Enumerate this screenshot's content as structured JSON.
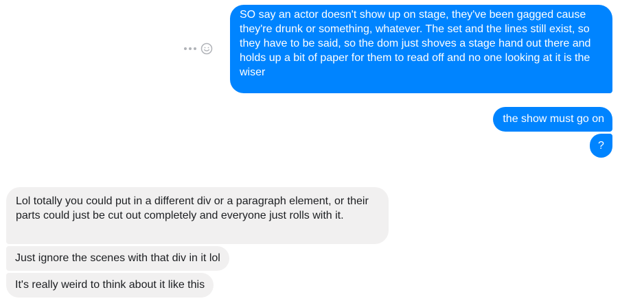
{
  "thread": {
    "outgoing": [
      {
        "text": "SO say an actor doesn't show up on stage, they've been gagged cause they're drunk or something, whatever. The set and the lines still exist, so they have to be said, so the dom just shoves a stage hand out there and holds up a bit of paper for them to read off and no one looking at it is the wiser"
      },
      {
        "text": "the show must go on"
      },
      {
        "text": "?"
      }
    ],
    "incoming": [
      {
        "text": "Lol totally you could put in a different div or a paragraph element, or their parts could just be cut out completely and everyone just rolls with it."
      },
      {
        "text": "Just ignore the scenes with that div in it lol"
      },
      {
        "text": "It's really weird to think about it like this"
      }
    ]
  },
  "message_actions": {
    "icons": [
      "more-icon",
      "emoji-reaction-icon"
    ]
  },
  "colors": {
    "outgoing_bubble": "#0084ff",
    "incoming_bubble": "#f1f0f0",
    "icon_gray": "#b0b3b8"
  }
}
